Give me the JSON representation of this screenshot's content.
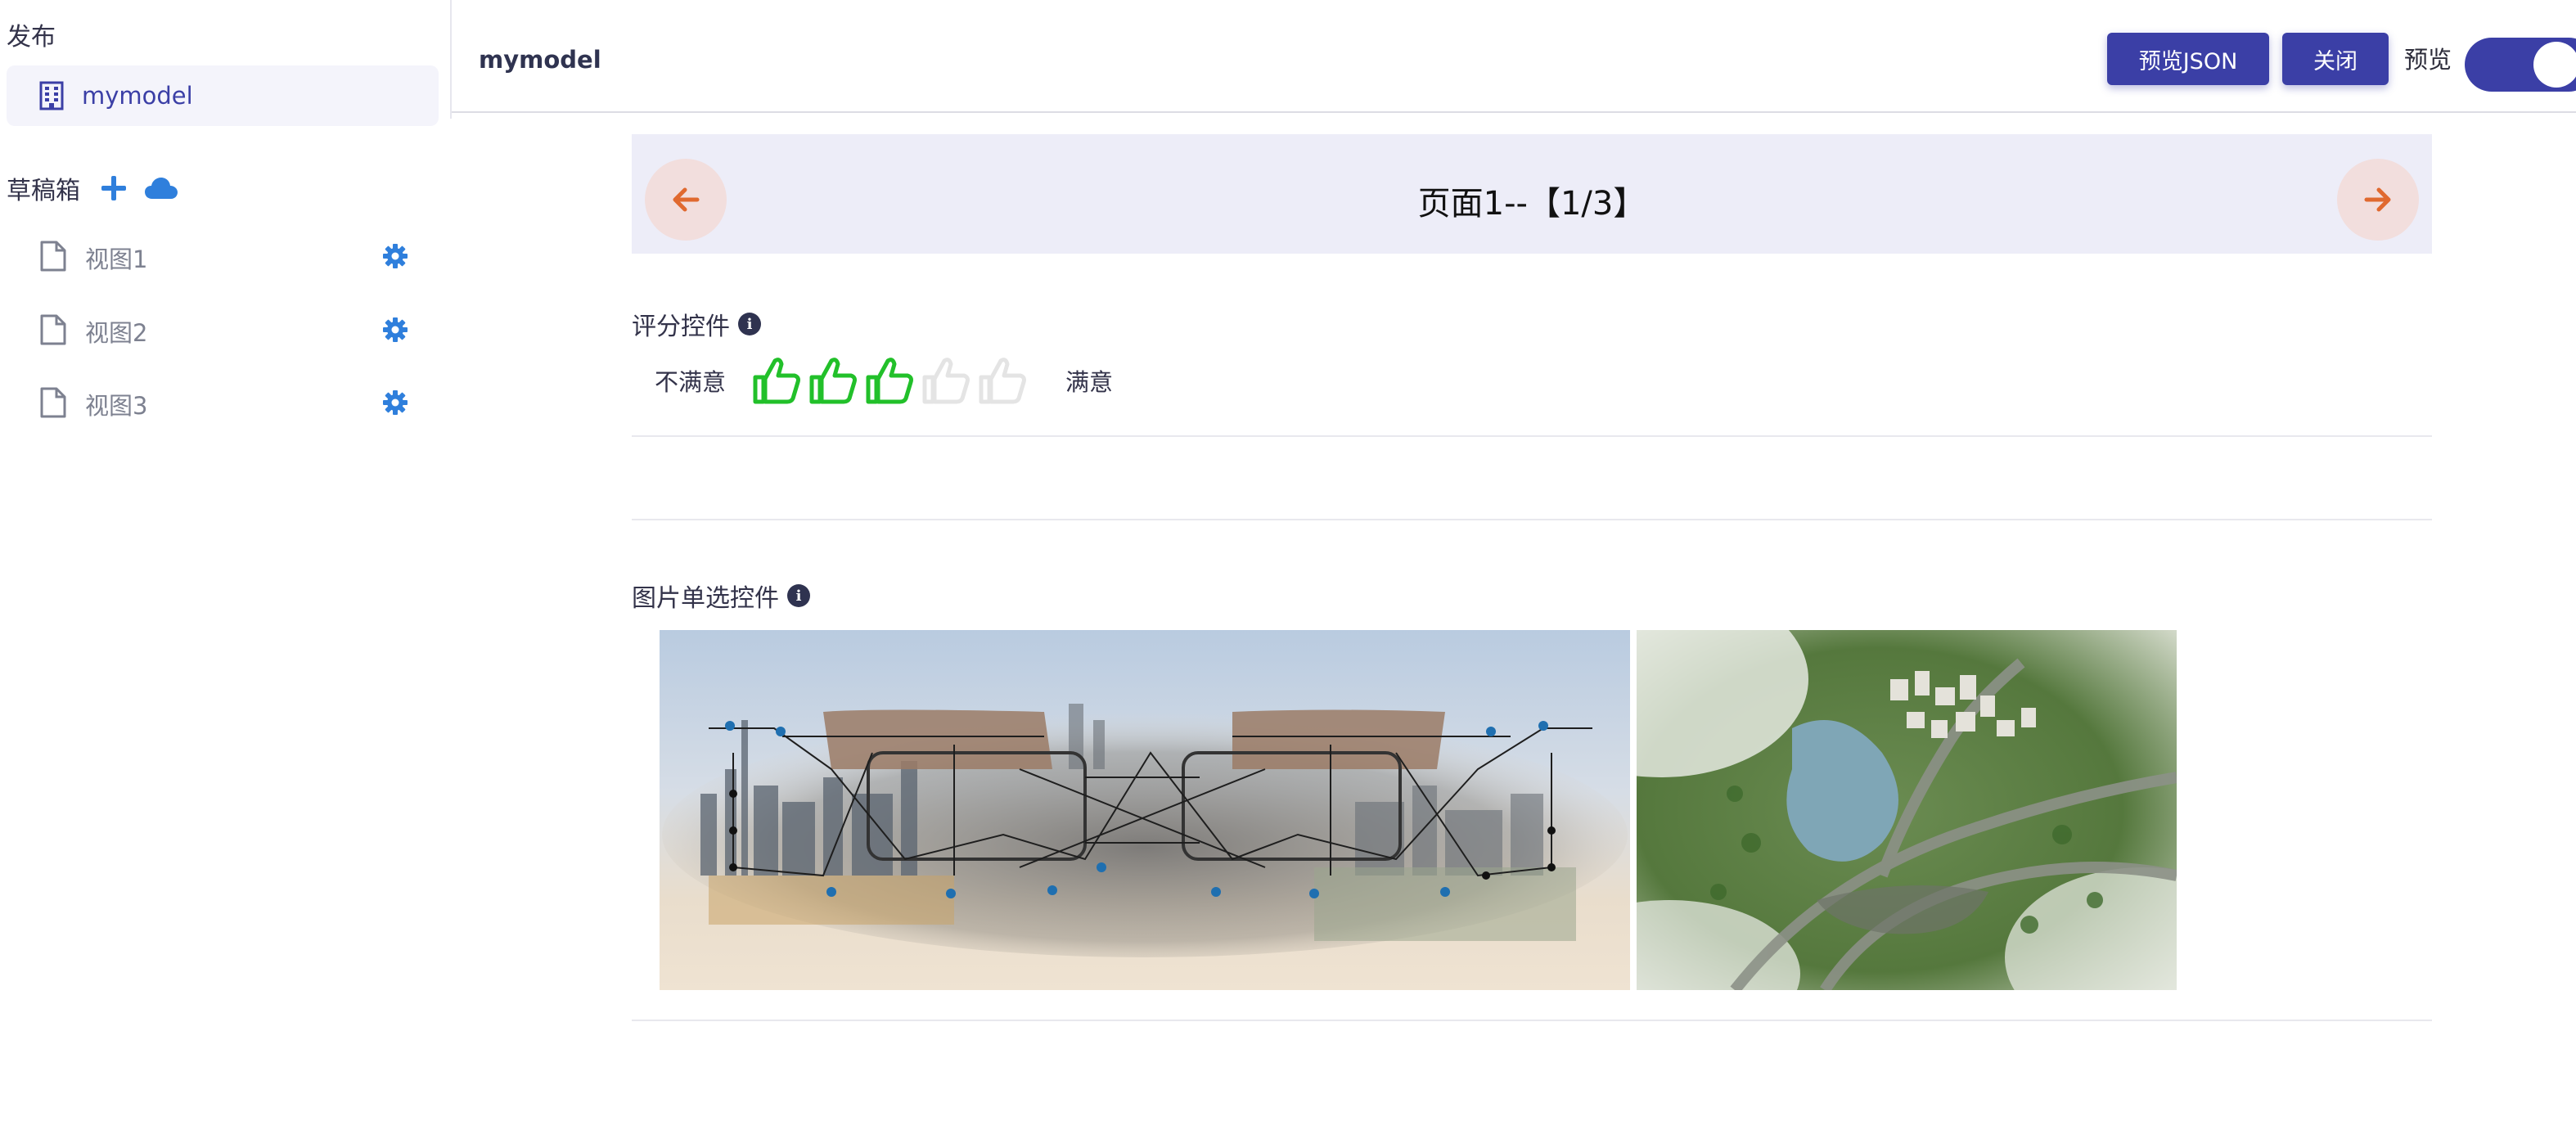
{
  "sidebar": {
    "publish_title": "发布",
    "model_name": "mymodel",
    "drafts_title": "草稿箱",
    "views": [
      {
        "label": "视图1"
      },
      {
        "label": "视图2"
      },
      {
        "label": "视图3"
      }
    ]
  },
  "header": {
    "title": "mymodel",
    "preview_json_label": "预览JSON",
    "close_label": "关闭",
    "preview_label": "预览",
    "preview_toggle_on": true
  },
  "pager": {
    "title": "页面1--【1/3】"
  },
  "rating_field": {
    "label": "评分控件",
    "low_label": "不满意",
    "high_label": "满意",
    "rating": 3,
    "max": 5
  },
  "image_field": {
    "label": "图片单选控件"
  },
  "colors": {
    "accent": "#3b3fa6",
    "blue_icon": "#2f7fdc",
    "thumb_on": "#22c02a",
    "thumb_off": "#e4e4e4",
    "arrow": "#e0692f",
    "arrow_bg": "#f2dedd",
    "pager_bg": "#ededf8"
  },
  "icons": {
    "model": "building-icon",
    "add": "plus-icon",
    "cloud": "cloud-icon",
    "view": "document-icon",
    "settings": "gear-icon",
    "prev": "arrow-left-icon",
    "next": "arrow-right-icon",
    "info": "info-icon",
    "rating": "thumbs-up-icon"
  }
}
